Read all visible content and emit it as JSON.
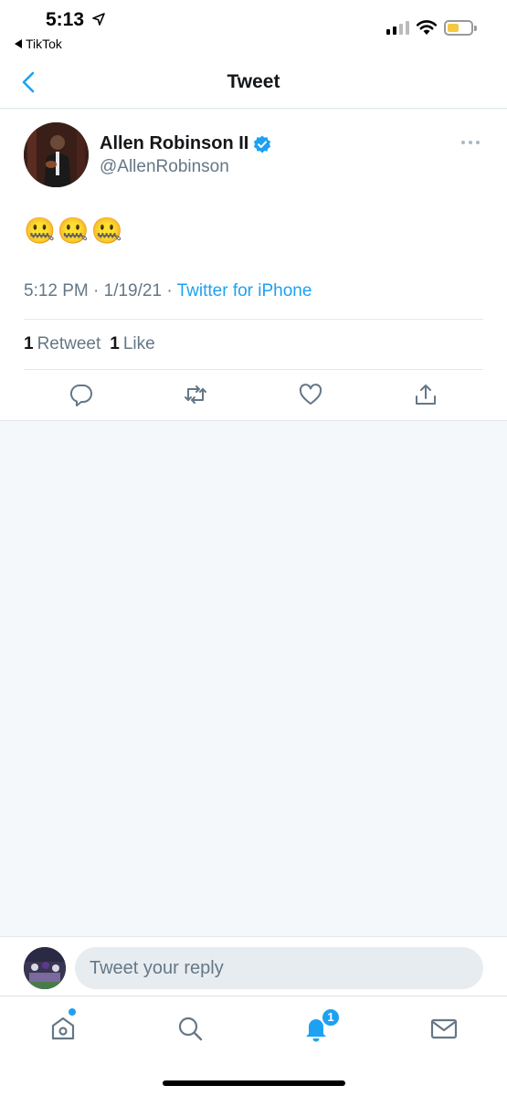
{
  "status_bar": {
    "time": "5:13",
    "back_app": "TikTok",
    "signal_bars_filled": 2,
    "battery_level": "low",
    "battery_color": "#f5c843"
  },
  "nav": {
    "title": "Tweet",
    "back_icon": "chevron-left-icon"
  },
  "tweet": {
    "author_name": "Allen Robinson II",
    "verified": true,
    "handle": "@AllenRobinson",
    "text": "🤐🤐🤐",
    "time": "5:12 PM · 1/19/21 ·",
    "source": "Twitter for iPhone",
    "retweet_count": "1",
    "retweet_label": "Retweet",
    "like_count": "1",
    "like_label": "Like",
    "actions": [
      "reply-icon",
      "retweet-icon",
      "like-icon",
      "share-icon"
    ]
  },
  "reply": {
    "placeholder": "Tweet your reply"
  },
  "tabbar": {
    "tabs": [
      "home-icon",
      "search-icon",
      "notifications-icon",
      "messages-icon"
    ],
    "notification_count": "1"
  },
  "colors": {
    "accent": "#1da1f2",
    "secondary_text": "#657786",
    "divider": "#e1e8ed",
    "background": "#f5f8fa"
  }
}
